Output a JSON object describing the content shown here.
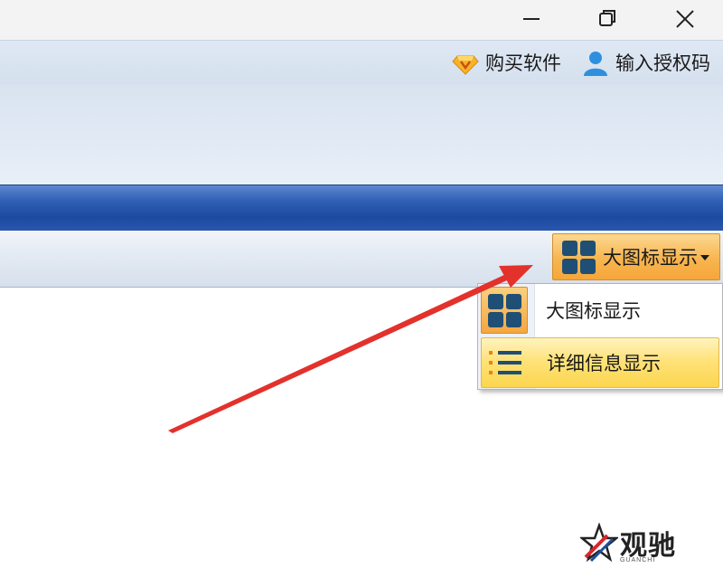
{
  "window_controls": {
    "minimize_icon": "minimize-icon",
    "restore_icon": "restore-icon",
    "close_icon": "close-icon"
  },
  "header_links": {
    "buy": {
      "label": "购买软件",
      "icon": "diamond-icon"
    },
    "license": {
      "label": "输入授权码",
      "icon": "user-icon"
    }
  },
  "toolbar": {
    "view_button": {
      "label": "大图标显示",
      "icon": "grid-view-icon",
      "has_dropdown": true
    }
  },
  "view_menu": {
    "items": [
      {
        "label": "大图标显示",
        "icon": "grid-view-icon"
      },
      {
        "label": "详细信息显示",
        "icon": "list-view-icon",
        "highlighted": true
      }
    ]
  },
  "watermark": {
    "title": "观驰",
    "subtitle": "GUANCHI"
  },
  "colors": {
    "accent_orange": "#f8b54f",
    "band_blue": "#1c4aa0",
    "arrow_red": "#e3312c",
    "icon_blue": "#1f4f74"
  }
}
